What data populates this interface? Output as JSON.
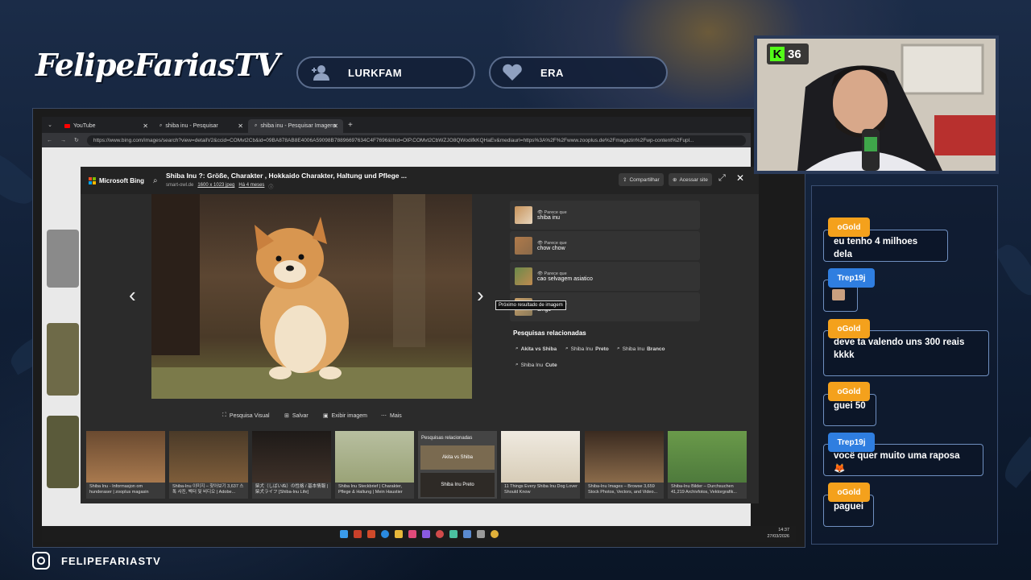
{
  "overlay_brand": "FelipeFariasTV",
  "top_buttons": [
    {
      "label": "LURKFAM",
      "icon": "add-user-icon"
    },
    {
      "label": "ERA",
      "icon": "heart-icon"
    }
  ],
  "browser": {
    "tabs": [
      {
        "label": "YouTube"
      },
      {
        "label": "shiba inu - Pesquisar"
      },
      {
        "label": "shiba inu - Pesquisar Imagens"
      }
    ],
    "url": "https://www.bing.com/images/search?view=detailV2&ccid=COMvt2Cb&id=09BA878AB8E4006A59098B78896697634C4F7696&thid=OIP.COMvt2CbWZJO8QWodifkKQHaEv&mediaurl=https%3A%2F%2Fwww.zooplus.de%2Fmagazin%2Fwp-content%2Fupl..."
  },
  "viewer": {
    "brand": "Microsoft Bing",
    "title": "Shiba Inu ?: Größe, Charakter , Hokkaido Charakter, Haltung und Pflege ...",
    "source": "smart-owl.de",
    "dims": "1600 x 1023 jpeg",
    "age": "Há 4 meses",
    "share": "Compartilhar",
    "visit": "Acessar site",
    "similar_label": "Parece que",
    "similar": [
      "shiba inu",
      "chow chow",
      "cao selvagem asiatico",
      "dingo"
    ],
    "tooltip": "Próximo resultado de imagem",
    "related_heading": "Pesquisas relacionadas",
    "related": [
      {
        "pre": "Akita vs Shiba",
        "bold": ""
      },
      {
        "pre": "Shiba Inu ",
        "bold": "Preto"
      },
      {
        "pre": "Shiba Inu ",
        "bold": "Branco"
      },
      {
        "pre": "Shiba Inu ",
        "bold": "Cute"
      }
    ],
    "actions": [
      "Pesquisa Visual",
      "Salvar",
      "Exibir imagem",
      "Mais"
    ],
    "strip": [
      {
        "cap": "Shiba Inu - Informasjon om hunderaser | zooplus magasin",
        "color": "#a8794e"
      },
      {
        "cap": "Shiba-Inu 이미지 – 찾아보기 3,637 스톡 사진, 벡터 및 비디오 | Adobe...",
        "color": "#7e5d3a"
      },
      {
        "cap": "柴犬（しばいぬ）の性格 / 基本情報 | 柴犬ライフ [Shiba-Inu Life]",
        "color": "#3d3028"
      },
      {
        "cap": "Shiba Inu Steckbrief | Charakter, Pflege & Haltung | Mein Haustier",
        "color": "#9aa377"
      },
      {
        "cap": "",
        "color": "#555"
      },
      {
        "cap": "11 Things Every Shiba Inu Dog Lover Should Know",
        "color": "#d8cdb8"
      },
      {
        "cap": "Shiba-Inu Images – Browse 3,659 Stock Photos, Vectors, and Video...",
        "color": "#5a4634"
      },
      {
        "cap": "Shiba-Inu Bilder – Durchsuchen 41,219 Archivfotos, Vektorgrafik...",
        "color": "#4e7a3c"
      }
    ],
    "strip_related_heading": "Pesquisas relacionadas",
    "strip_related": [
      "Akita vs Shiba",
      "Shiba Inu Preto"
    ]
  },
  "clock": {
    "time": "14:37",
    "date": "27/03/2026"
  },
  "kick_viewers": "36",
  "chat": [
    {
      "user": "oGold",
      "text": "eu tenho 4 milhoes dela",
      "color": "gold"
    },
    {
      "user": "Trep19j",
      "text": "",
      "color": "blue"
    },
    {
      "user": "oGold",
      "text": "deve ta valendo uns 300 reais kkkk",
      "color": "gold"
    },
    {
      "user": "oGold",
      "text": "guei 50",
      "color": "gold"
    },
    {
      "user": "Trep19j",
      "text": "você quer muito uma raposa 🦊",
      "color": "blue"
    },
    {
      "user": "oGold",
      "text": "paguei",
      "color": "gold"
    }
  ],
  "footer_handle": "FELIPEFARIASTV",
  "colors": {
    "kick": "#53fc18",
    "gold": "#f4a11c",
    "blue": "#2f7ee0"
  }
}
